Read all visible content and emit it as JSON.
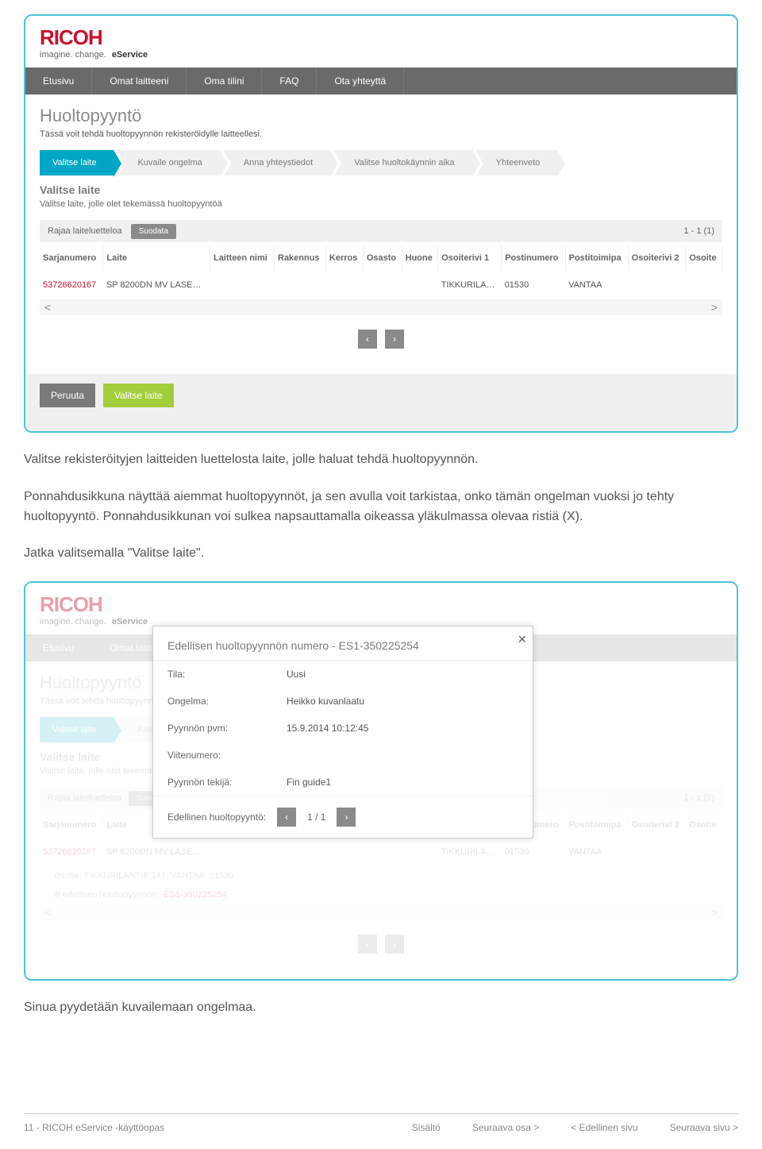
{
  "brand": {
    "logo": "RICOH",
    "tag": "imagine. change.",
    "eservice": "eService"
  },
  "topnav": [
    "Etusivu",
    "Omat laitteeni",
    "Oma tilini",
    "FAQ",
    "Ota yhteyttä"
  ],
  "page1": {
    "title": "Huoltopyyntö",
    "subtitle": "Tässä voit tehdä huoltopyynnön rekisteröidylle laitteellesi.",
    "wizard": [
      "Valitse laite",
      "Kuvaile ongelma",
      "Anna yhteystiedot",
      "Valitse huoltokäynnin aika",
      "Yhteenveto"
    ],
    "section": "Valitse laite",
    "section_sub": "Valitse laite, jolle olet tekemässä huoltopyyntöä",
    "filter_label": "Rajaa laiteluetteloa",
    "filter_btn": "Suodata",
    "count": "1 - 1 (1)",
    "columns": [
      "Sarjanumero",
      "Laite",
      "Laitteen nimi",
      "Rakennus",
      "Kerros",
      "Osasto",
      "Huone",
      "Osoiterivi 1",
      "Postinumero",
      "Postitoimipa",
      "Osoiterivi 2",
      "Osoite"
    ],
    "row": {
      "sn": "53726620167",
      "laite": "SP 8200DN MV LASE…",
      "osoite1": "TIKKURILA…",
      "postinum": "01530",
      "postitoimi": "VANTAA"
    },
    "cancel": "Peruuta",
    "select": "Valitse laite"
  },
  "para1a": "Valitse rekisteröityjen laitteiden luettelosta laite, jolle haluat tehdä huoltopyynnön.",
  "para1b": "Ponnahdusikkuna näyttää aiemmat huoltopyynnöt, ja sen avulla voit tarkistaa, onko tämän ongelman vuoksi jo tehty huoltopyyntö. Ponnahdusikkunan voi sulkea napsauttamalla oikeassa yläkulmassa olevaa ristiä (X).",
  "para1c": "Jatka valitsemalla \"Valitse laite\".",
  "popup": {
    "title": "Edellisen huoltopyynnön numero - ES1-350225254",
    "rows": [
      {
        "label": "Tila:",
        "value": "Uusi"
      },
      {
        "label": "Ongelma:",
        "value": "Heikko kuvanlaatu"
      },
      {
        "label": "Pyynnön pvm:",
        "value": "15.9.2014 10:12:45"
      },
      {
        "label": "Viitenumero:",
        "value": ""
      },
      {
        "label": "Pyynnön tekijä:",
        "value": "Fin guide1"
      }
    ],
    "footer_label": "Edellinen huoltopyyntö:",
    "footer_page": "1 / 1"
  },
  "bg2": {
    "osoite_line": "Osoite: TIKKURILANTIE 141.    VANTAA.  01530",
    "prev_req_label": "iti edellisen huoltopyynnön::",
    "prev_req_link": "ES1-350225254"
  },
  "para2": "Sinua pyydetään kuvailemaan ongelmaa.",
  "footer": {
    "left": "11 - RICOH eService -käyttöopas",
    "contents": "Sisältö",
    "next_section": "Seuraava osa >",
    "prev_page": "< Edellinen sivu",
    "next_page": "Seuraava sivu >"
  }
}
